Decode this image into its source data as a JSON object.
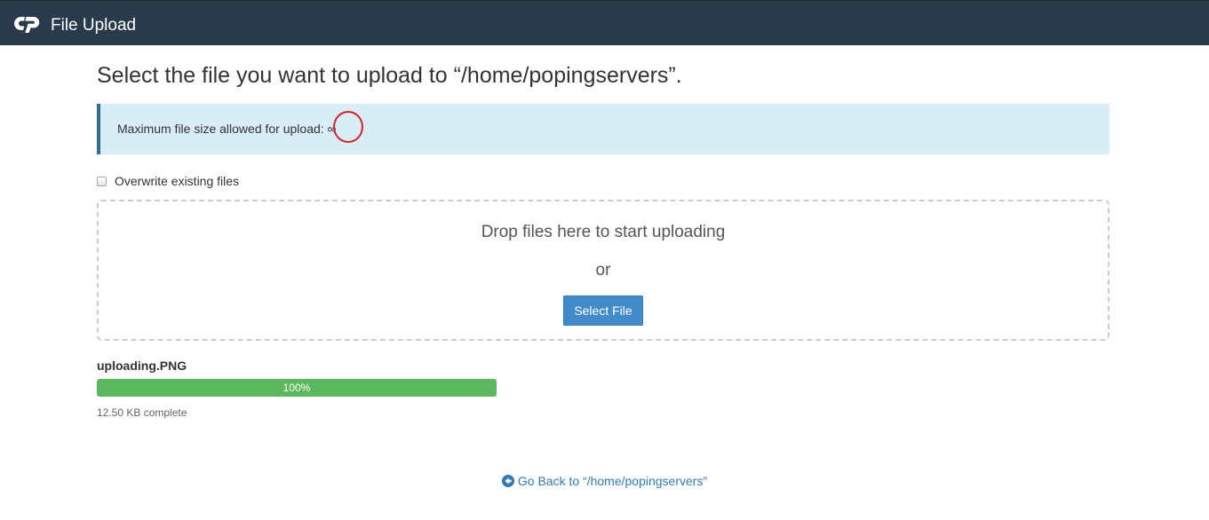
{
  "header": {
    "app_name": "File Upload",
    "logo_icon": "cpanel-logo-icon",
    "background": "#293a4a"
  },
  "main": {
    "heading": "Select the file you want to upload to “/home/popingservers”.",
    "info": {
      "text": "Maximum file size allowed for upload: ∞",
      "background": "#d9edf7"
    },
    "overwrite": {
      "label": "Overwrite existing files",
      "checked": false
    },
    "dropzone": {
      "drop_text": "Drop files here to start uploading",
      "or_text": "or",
      "select_button": "Select File"
    },
    "upload": {
      "file_name": "uploading.PNG",
      "progress_percent": 100,
      "progress_label": "100%",
      "status": "12.50 KB complete",
      "progress_color": "#5cb85c"
    },
    "back_link": {
      "icon": "arrow-circle-left-icon",
      "text": "Go Back to “/home/popingservers”"
    }
  }
}
